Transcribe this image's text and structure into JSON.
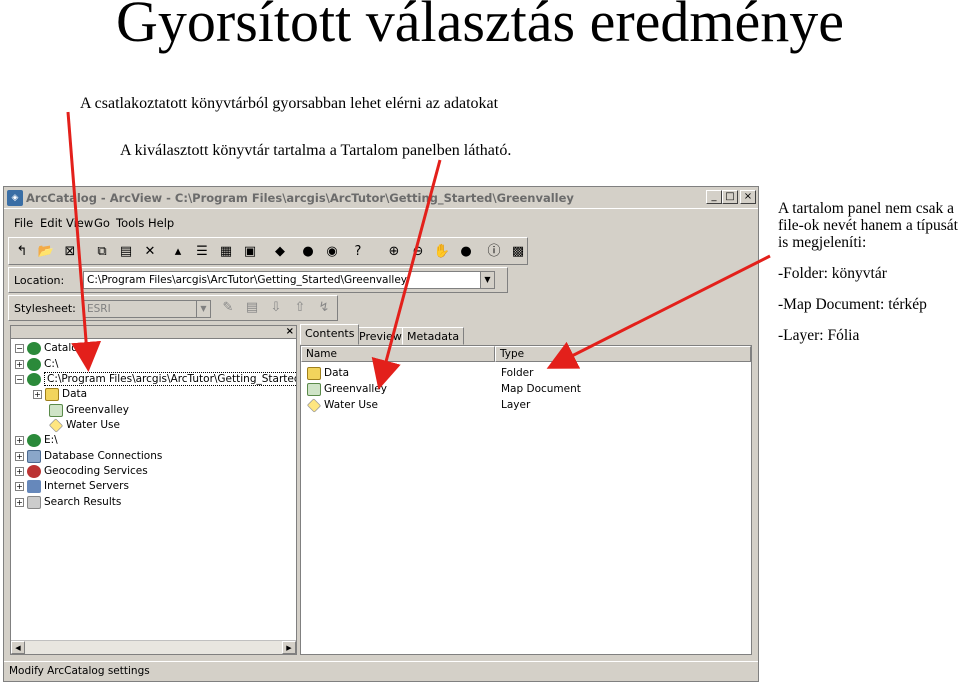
{
  "slide": {
    "title": "Gyorsított választás eredménye",
    "note_1": "A csatlakoztatott könyvtárból gyorsabban lehet elérni az adatokat",
    "note_2": "A kiválasztott könyvtár tartalma a Tartalom panelben látható.",
    "side_desc": "A tartalom panel nem csak a file-ok nevét hanem a típusát is megjeleníti:",
    "side_folder": "-Folder: könyvtár",
    "side_map": "-Map Document: térkép",
    "side_layer": "-Layer: Fólia",
    "arrow_color": "#e3201b"
  },
  "window": {
    "title": "ArcCatalog - ArcView - C:\\Program Files\\arcgis\\ArcTutor\\Getting_Started\\Greenvalley",
    "menu": [
      "File",
      "Edit",
      "View",
      "Go",
      "Tools",
      "Help"
    ],
    "location_label": "Location:",
    "location_value": "C:\\Program Files\\arcgis\\ArcTutor\\Getting_Started\\Greenvalley",
    "stylesheet_label": "Stylesheet:",
    "stylesheet_value": "ESRI",
    "tree": {
      "root": "Catalog",
      "c_drive": "C:\\",
      "selected": "C:\\Program Files\\arcgis\\ArcTutor\\Getting_Started\\Greenvalley",
      "child_data": "Data",
      "child_greenvalley": "Greenvalley",
      "child_wateruse": "Water Use",
      "e_drive": "E:\\",
      "db_connections": "Database Connections",
      "geocoding": "Geocoding Services",
      "internet": "Internet Servers",
      "search": "Search Results"
    },
    "tabs": [
      "Contents",
      "Preview",
      "Metadata"
    ],
    "columns": {
      "name": "Name",
      "type": "Type"
    },
    "items": [
      {
        "name": "Data",
        "type": "Folder"
      },
      {
        "name": "Greenvalley",
        "type": "Map Document"
      },
      {
        "name": "Water Use",
        "type": "Layer"
      }
    ],
    "status": "Modify ArcCatalog settings"
  }
}
